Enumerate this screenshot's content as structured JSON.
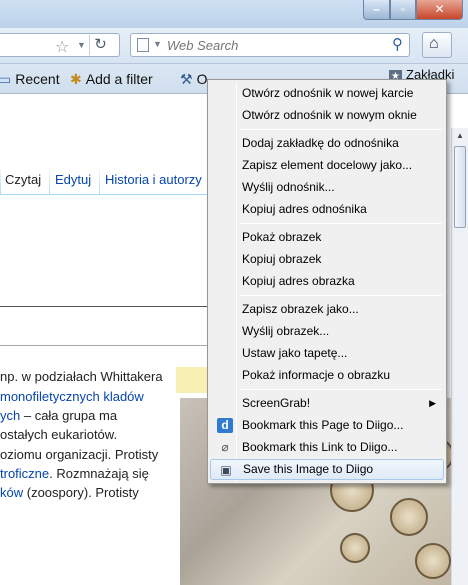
{
  "window": {
    "minimize_icon": "minimize-icon",
    "maximize_icon": "maximize-icon",
    "close_icon": "close-icon"
  },
  "navbar": {
    "search_placeholder": "Web Search",
    "star_glyph": "☆",
    "reload_glyph": "↻",
    "search_go_glyph": "⚲",
    "home_glyph": "⌂"
  },
  "bookmarks": {
    "items": [
      {
        "label": "Recent",
        "icon": "folder-icon"
      },
      {
        "label": "Add a filter",
        "icon": "filter-icon"
      },
      {
        "label": "O",
        "icon": "tool-icon"
      }
    ],
    "right_label": "Zakładki"
  },
  "page": {
    "tabs": [
      "Czytaj",
      "Edytuj",
      "Historia i autorzy"
    ],
    "paragraph": [
      {
        "text": "np. w podziałach Whittakera",
        "link": false
      },
      {
        "text": "monofiletycznych kladów",
        "link": true
      },
      {
        "pre_link": "ych",
        "text": " – cała grupa ma",
        "link": false
      },
      {
        "text": "ostałych eukariotów.",
        "link": false
      },
      {
        "text": "oziomu organizacji. Protisty",
        "link": false
      },
      {
        "pre_link": "troficzne",
        "text": ". Rozmnażają się",
        "link": false
      },
      {
        "pre_link": "ków",
        "text": " (zoospory). Protisty",
        "link": false
      }
    ]
  },
  "context_menu": {
    "items": [
      "Otwórz odnośnik w nowej karcie",
      "Otwórz odnośnik w nowym oknie",
      "Dodaj zakładkę do odnośnika",
      "Zapisz element docelowy jako...",
      "Wyślij odnośnik...",
      "Kopiuj adres odnośnika",
      "Pokaż obrazek",
      "Kopiuj obrazek",
      "Kopiuj adres obrazka",
      "Zapisz obrazek jako...",
      "Wyślij obrazek...",
      "Ustaw jako tapetę...",
      "Pokaż informacje o obrazku",
      "ScreenGrab!",
      "Bookmark this Page to Diigo...",
      "Bookmark this Link to Diigo...",
      "Save this Image to Diigo"
    ],
    "highlighted": "Save this Image to Diigo",
    "accent_color": "#a8c8ec"
  }
}
